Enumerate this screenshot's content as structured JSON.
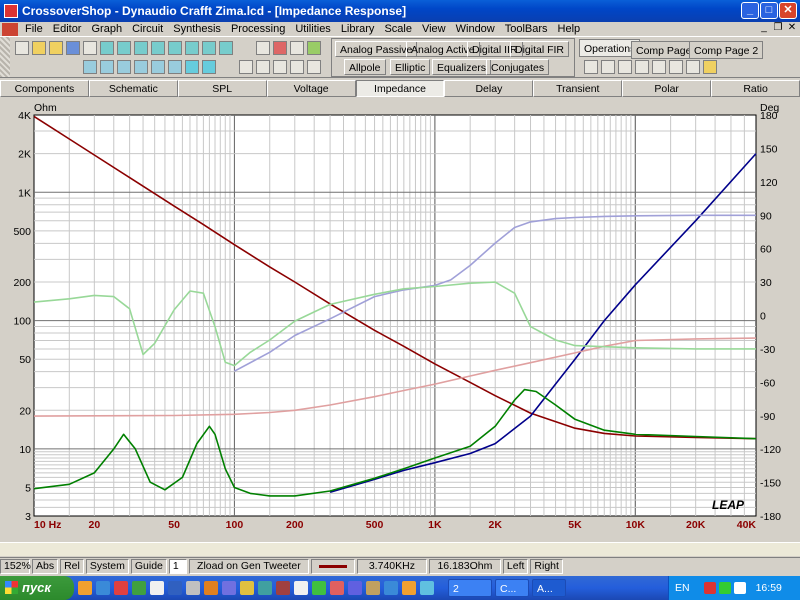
{
  "window": {
    "title": "CrossoverShop - Dynaudio Crafft Zima.lcd - [Impedance Response]",
    "minimize": "_",
    "maximize": "□",
    "close": "✕",
    "doc_minimize": "_",
    "doc_restore": "❐",
    "doc_close": "✕"
  },
  "menu": [
    "File",
    "Editor",
    "Graph",
    "Circuit",
    "Synthesis",
    "Processing",
    "Utilities",
    "Library",
    "Scale",
    "View",
    "Window",
    "ToolBars",
    "Help"
  ],
  "toolbar": {
    "synthesis_row1": [
      "Analog Passive",
      "Analog Active",
      "Digital IIR",
      "Digital FIR"
    ],
    "synthesis_row2": [
      "Allpole",
      "Elliptic",
      "Equalizers",
      "Conjugates"
    ],
    "pages": [
      "Operations",
      "Comp Page 1",
      "Comp Page 2"
    ]
  },
  "tabs": [
    "Components",
    "Schematic",
    "SPL",
    "Voltage",
    "Impedance",
    "Delay",
    "Transient",
    "Polar",
    "Ratio"
  ],
  "active_tab": "Impedance",
  "chart_data": {
    "type": "line",
    "title": "",
    "xlabel": "",
    "ylabel_left": "Ohm",
    "ylabel_right": "Deg",
    "x_scale": "log",
    "y_scale_left": "log",
    "xlim": [
      10,
      40000
    ],
    "ylim_left": [
      3,
      4000
    ],
    "ylim_right": [
      -180,
      180
    ],
    "grid": true,
    "x_ticks": [
      "10 Hz",
      "20",
      "50",
      "100",
      "200",
      "500",
      "1K",
      "2K",
      "5K",
      "10K",
      "20K",
      "40K"
    ],
    "x_tick_values": [
      10,
      20,
      50,
      100,
      200,
      500,
      1000,
      2000,
      5000,
      10000,
      20000,
      40000
    ],
    "y_ticks_left": [
      "4K",
      "2K",
      "1K",
      "500",
      "200",
      "100",
      "50",
      "20",
      "10",
      "5",
      "3"
    ],
    "y_tick_values_left": [
      4000,
      2000,
      1000,
      500,
      200,
      100,
      50,
      20,
      10,
      5,
      3
    ],
    "y_ticks_right": [
      "180",
      "150",
      "120",
      "90",
      "60",
      "30",
      "0",
      "-30",
      "-60",
      "-90",
      "-120",
      "-150",
      "-180"
    ],
    "y_tick_values_right": [
      180,
      150,
      120,
      90,
      60,
      30,
      0,
      -30,
      -60,
      -90,
      -120,
      -150,
      -180
    ],
    "watermark": "LEAP",
    "series": [
      {
        "axis": "left",
        "color": "#8b0000",
        "x": [
          10,
          15,
          20,
          30,
          50,
          70,
          100,
          150,
          200,
          300,
          500,
          700,
          1000,
          1500,
          2000,
          3000,
          5000,
          7000,
          10000,
          20000,
          40000
        ],
        "y": [
          3900,
          2600,
          1950,
          1300,
          780,
          560,
          390,
          262,
          200,
          135,
          84,
          63,
          46,
          33,
          26,
          19,
          14.5,
          13.2,
          12.6,
          12.3,
          12
        ]
      },
      {
        "axis": "left",
        "color": "#00008b",
        "x": [
          300,
          500,
          700,
          1000,
          1500,
          2000,
          3000,
          5000,
          7000,
          10000,
          20000,
          40000
        ],
        "y": [
          4.6,
          5.8,
          6.8,
          7.8,
          9.2,
          11,
          18,
          50,
          100,
          190,
          600,
          2000
        ]
      },
      {
        "axis": "left",
        "color": "#008000",
        "x": [
          10,
          15,
          20,
          25,
          28,
          32,
          38,
          45,
          55,
          65,
          75,
          80,
          90,
          100,
          120,
          150,
          200,
          300,
          500,
          700,
          1000,
          1500,
          2000,
          2500,
          2800,
          3200,
          4000,
          5000,
          7000,
          10000,
          20000,
          40000
        ],
        "y": [
          4.9,
          5.3,
          6.5,
          10,
          13,
          10,
          5.5,
          4.8,
          6,
          11,
          15,
          13,
          7,
          5,
          4.5,
          4.3,
          4.3,
          4.7,
          5.9,
          7,
          8.5,
          10.5,
          15,
          24,
          29,
          28,
          22,
          17,
          14,
          13,
          12.5,
          12
        ]
      },
      {
        "axis": "left",
        "color": "#e0a0a0",
        "x": [
          10,
          50,
          100,
          150,
          200,
          300,
          500,
          700,
          1000,
          1500,
          2000,
          3000,
          5000,
          7000,
          10000,
          20000,
          40000
        ],
        "y": [
          18,
          18.2,
          18.6,
          19.2,
          20,
          22,
          25.5,
          28.5,
          32,
          37,
          41,
          47,
          56,
          63,
          70,
          72,
          73
        ]
      },
      {
        "axis": "right",
        "color": "#a0a0d8",
        "x": [
          100,
          150,
          200,
          300,
          500,
          700,
          1000,
          1200,
          1500,
          2000,
          2500,
          3000,
          4000,
          5000,
          7000,
          10000,
          20000,
          40000
        ],
        "y": [
          -50,
          -33,
          -18,
          -3,
          17,
          23,
          27,
          32,
          45,
          65,
          79,
          84,
          87,
          88,
          89,
          89.5,
          90,
          90
        ]
      },
      {
        "axis": "right",
        "color": "#98d898",
        "x": [
          10,
          15,
          20,
          25,
          30,
          35,
          40,
          50,
          60,
          70,
          80,
          90,
          100,
          120,
          150,
          200,
          300,
          500,
          700,
          1000,
          1500,
          2000,
          2500,
          3000,
          4000,
          5000,
          7000,
          10000,
          20000,
          40000
        ],
        "y": [
          12,
          15,
          18,
          17,
          6,
          -35,
          -25,
          5,
          22,
          20,
          -10,
          -42,
          -45,
          -33,
          -22,
          -5,
          10,
          19,
          24,
          26,
          29,
          30,
          20,
          -10,
          -22,
          -27,
          -28,
          -29,
          -30,
          -30
        ]
      }
    ]
  },
  "status": {
    "zoom": "152%",
    "abs": "Abs",
    "rel": "Rel",
    "system": "System",
    "guide": "Guide",
    "guide_value": "1",
    "curve_label": "Zload on Gen Tweeter",
    "frequency": "3.740KHz",
    "value": "16.183Ohm",
    "left": "Left",
    "right": "Right"
  },
  "taskbar": {
    "start": "пуск",
    "task1": "2",
    "task2": "C...",
    "task3": "A...",
    "lang": "EN",
    "clock": "16:59"
  }
}
